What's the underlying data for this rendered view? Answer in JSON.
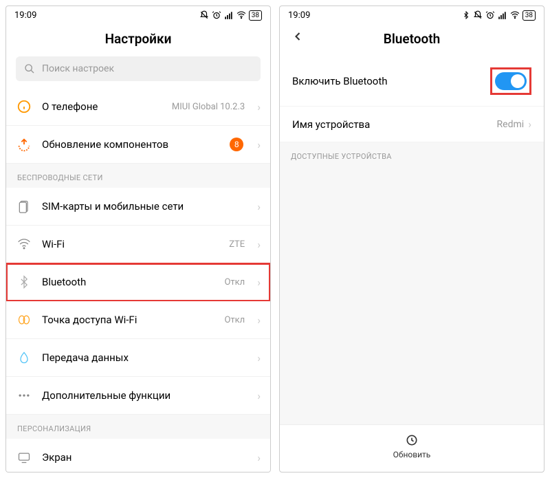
{
  "status": {
    "time": "19:09",
    "battery": "38"
  },
  "left": {
    "title": "Настройки",
    "search_placeholder": "Поиск настроек",
    "items": {
      "about": {
        "label": "О телефоне",
        "value": "MIUI Global 10.2.3"
      },
      "update": {
        "label": "Обновление компонентов",
        "badge": "8"
      }
    },
    "sections": {
      "wireless": "БЕСПРОВОДНЫЕ СЕТИ",
      "personalization": "ПЕРСОНАЛИЗАЦИЯ"
    },
    "wireless": {
      "sim": {
        "label": "SIM-карты и мобильные сети"
      },
      "wifi": {
        "label": "Wi-Fi",
        "value": "ZTE"
      },
      "bluetooth": {
        "label": "Bluetooth",
        "value": "Откл"
      },
      "hotspot": {
        "label": "Точка доступа Wi-Fi",
        "value": "Откл"
      },
      "data": {
        "label": "Передача данных"
      },
      "more": {
        "label": "Дополнительные функции"
      }
    },
    "personalization": {
      "display": {
        "label": "Экран"
      }
    }
  },
  "right": {
    "title": "Bluetooth",
    "enable_label": "Включить Bluetooth",
    "device_name_label": "Имя устройства",
    "device_name_value": "Redmi",
    "available_devices": "ДОСТУПНЫЕ УСТРОЙСТВА",
    "refresh": "Обновить"
  }
}
